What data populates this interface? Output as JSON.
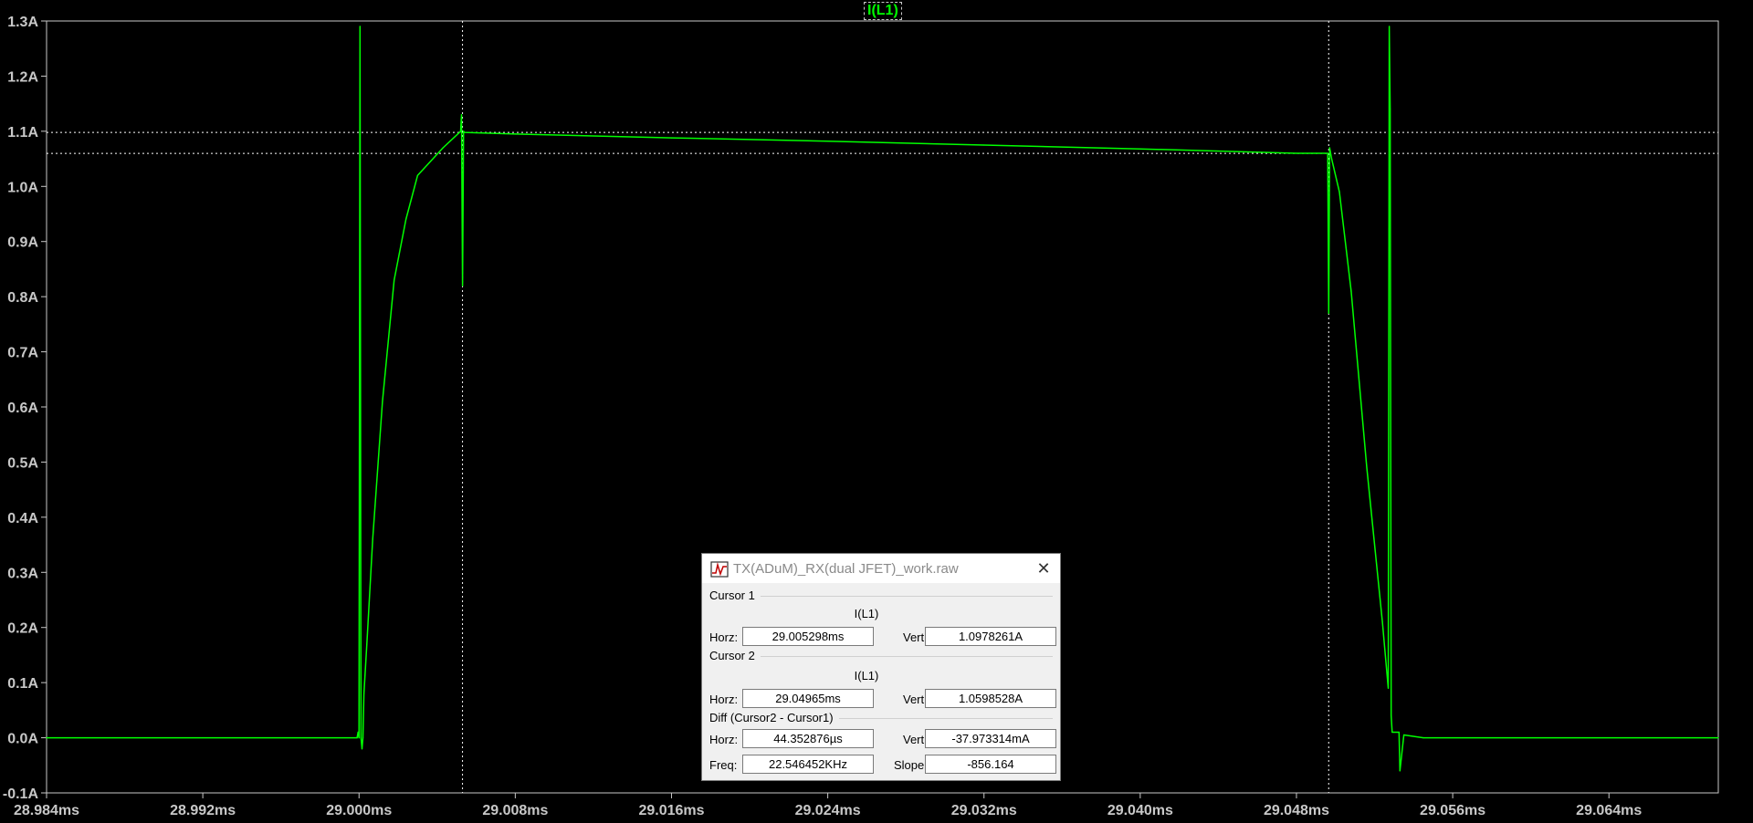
{
  "colors": {
    "background": "#000000",
    "trace": "#00ff00",
    "grid_frame": "#c8c8c8",
    "cursor_line": "#ffffff"
  },
  "trace_label": "I(L1)",
  "chart_data": {
    "type": "line",
    "xlabel": "",
    "ylabel": "",
    "xlim": [
      28.984,
      29.0696
    ],
    "ylim": [
      -0.1,
      1.3
    ],
    "x_ticks": [
      "28.984ms",
      "28.992ms",
      "29.000ms",
      "29.008ms",
      "29.016ms",
      "29.024ms",
      "29.032ms",
      "29.040ms",
      "29.048ms",
      "29.056ms",
      "29.064ms"
    ],
    "y_ticks": [
      "1.3A",
      "1.2A",
      "1.1A",
      "1.0A",
      "0.9A",
      "0.8A",
      "0.7A",
      "0.6A",
      "0.5A",
      "0.4A",
      "0.3A",
      "0.2A",
      "0.1A",
      "0.0A",
      "-0.1A"
    ],
    "grid": false,
    "cursors": {
      "cursor1": {
        "x": 29.005298,
        "y": 1.0978261
      },
      "cursor2": {
        "x": 29.04965,
        "y": 1.0598528
      }
    },
    "series": [
      {
        "x": [
          28.984,
          28.9999,
          28.99995,
          29.0,
          29.00005,
          29.0001,
          29.00015,
          29.0002,
          29.00025,
          29.0004,
          29.0007,
          29.0012,
          29.0018,
          29.0024,
          29.003,
          29.0043,
          29.0052,
          29.00525,
          29.0053,
          29.00535,
          29.0054,
          29.008,
          29.016,
          29.024,
          29.032,
          29.04,
          29.048,
          29.0496,
          29.04965,
          29.0497,
          29.04975,
          29.0498,
          29.0502,
          29.0508,
          29.0516,
          29.0524,
          29.0527,
          29.05275,
          29.0528,
          29.05285,
          29.0529,
          29.053,
          29.05325,
          29.0533,
          29.0535,
          29.0545,
          29.0696
        ],
        "y": [
          0.0,
          0.0,
          0.01,
          0.0,
          1.29,
          0.0,
          -0.02,
          0.0,
          0.08,
          0.17,
          0.36,
          0.61,
          0.83,
          0.94,
          1.02,
          1.07,
          1.1,
          1.13,
          0.82,
          1.1,
          1.098,
          1.095,
          1.088,
          1.082,
          1.075,
          1.068,
          1.06,
          1.06,
          0.77,
          1.07,
          1.06,
          1.05,
          0.99,
          0.81,
          0.49,
          0.21,
          0.09,
          1.29,
          1.14,
          0.04,
          0.01,
          0.01,
          0.01,
          -0.06,
          0.005,
          0.0,
          0.0
        ]
      }
    ]
  },
  "dialog": {
    "title": "TX(ADuM)_RX(dual JFET)_work.raw",
    "close_glyph": "✕",
    "cursor1": {
      "title": "Cursor 1",
      "trace": "I(L1)",
      "horz_label": "Horz:",
      "horz": "29.005298ms",
      "vert_label": "Vert:",
      "vert": "1.0978261A"
    },
    "cursor2": {
      "title": "Cursor 2",
      "trace": "I(L1)",
      "horz_label": "Horz:",
      "horz": "29.04965ms",
      "vert_label": "Vert:",
      "vert": "1.0598528A"
    },
    "diff": {
      "title": "Diff (Cursor2 - Cursor1)",
      "horz_label": "Horz:",
      "horz": "44.352876µs",
      "vert_label": "Vert:",
      "vert": "-37.973314mA",
      "freq_label": "Freq:",
      "freq": "22.546452KHz",
      "slope_label": "Slope:",
      "slope": "-856.164"
    }
  }
}
